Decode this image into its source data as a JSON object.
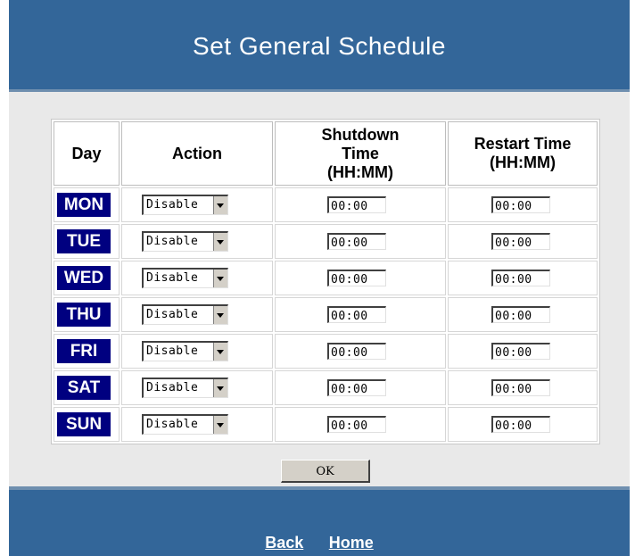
{
  "header": {
    "title": "Set General Schedule"
  },
  "table": {
    "headers": {
      "day": "Day",
      "action": "Action",
      "shutdown_l1": "Shutdown",
      "shutdown_l2": "Time",
      "shutdown_l3": "(HH:MM)",
      "restart_l1": "Restart Time",
      "restart_l2": "(HH:MM)"
    },
    "rows": [
      {
        "day": "MON",
        "action": "Disable",
        "shutdown": "00:00",
        "restart": "00:00"
      },
      {
        "day": "TUE",
        "action": "Disable",
        "shutdown": "00:00",
        "restart": "00:00"
      },
      {
        "day": "WED",
        "action": "Disable",
        "shutdown": "00:00",
        "restart": "00:00"
      },
      {
        "day": "THU",
        "action": "Disable",
        "shutdown": "00:00",
        "restart": "00:00"
      },
      {
        "day": "FRI",
        "action": "Disable",
        "shutdown": "00:00",
        "restart": "00:00"
      },
      {
        "day": "SAT",
        "action": "Disable",
        "shutdown": "00:00",
        "restart": "00:00"
      },
      {
        "day": "SUN",
        "action": "Disable",
        "shutdown": "00:00",
        "restart": "00:00"
      }
    ]
  },
  "ok_label": "OK",
  "footer": {
    "back": "Back",
    "home": "Home"
  },
  "colors": {
    "banner": "#336699",
    "day_badge": "#000080",
    "panel": "#e9e9e9"
  }
}
